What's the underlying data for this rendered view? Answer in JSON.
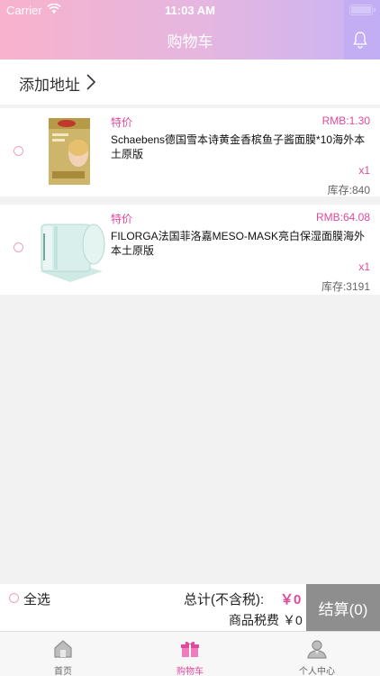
{
  "status": {
    "carrier": "Carrier",
    "time": "11:03 AM"
  },
  "header": {
    "title": "购物车"
  },
  "address": {
    "label": "添加地址"
  },
  "items": [
    {
      "tag": "特价",
      "price": "RMB:1.30",
      "name": "Schaebens德国雪本诗黄金香槟鱼子酱面膜*10海外本土原版",
      "qty": "x1",
      "stock": "库存:840"
    },
    {
      "tag": "特价",
      "price": "RMB:64.08",
      "name": "FILORGA法国菲洛嘉MESO-MASK亮白保湿面膜海外本土原版",
      "qty": "x1",
      "stock": "库存:3191"
    }
  ],
  "footer": {
    "select_all": "全选",
    "total_label": "总计(不含税):",
    "total_value": "￥0",
    "tax_label": "商品税费",
    "tax_value": "￥0",
    "checkout": "结算(0)"
  },
  "tabs": [
    {
      "label": "首页",
      "icon": "home-icon"
    },
    {
      "label": "购物车",
      "icon": "cart-icon"
    },
    {
      "label": "个人中心",
      "icon": "user-icon"
    }
  ],
  "colors": {
    "accent": "#e0499c",
    "header_start": "#f8b2cc",
    "header_end": "#c9b4f4",
    "checkout_bg": "#8e8e8e"
  }
}
